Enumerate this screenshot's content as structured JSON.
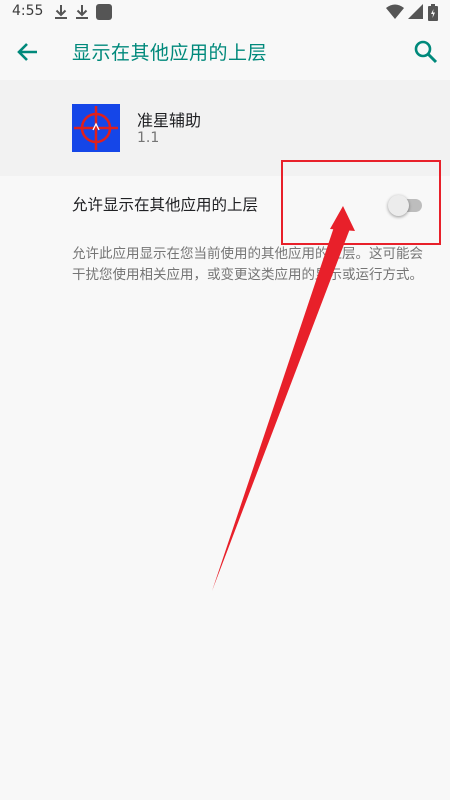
{
  "status_bar": {
    "time": "4:55",
    "icons": [
      "download-icon",
      "download-icon",
      "notification-square-icon",
      "wifi-icon",
      "signal-icon",
      "battery-icon"
    ]
  },
  "app_bar": {
    "title": "显示在其他应用的上层",
    "back_icon": "back-arrow-icon",
    "search_icon": "search-icon",
    "accent_color": "#00897b"
  },
  "app_info": {
    "name": "准星辅助",
    "version": "1.1",
    "icon": "crosshair-icon"
  },
  "setting": {
    "label": "允许显示在其他应用的上层",
    "enabled": false
  },
  "description": "允许此应用显示在您当前使用的其他应用的上层。这可能会干扰您使用相关应用，或变更这类应用的显示或运行方式。",
  "annotation": {
    "color": "#e8202a",
    "shapes": [
      "highlight-box",
      "pointer-arrow"
    ]
  }
}
